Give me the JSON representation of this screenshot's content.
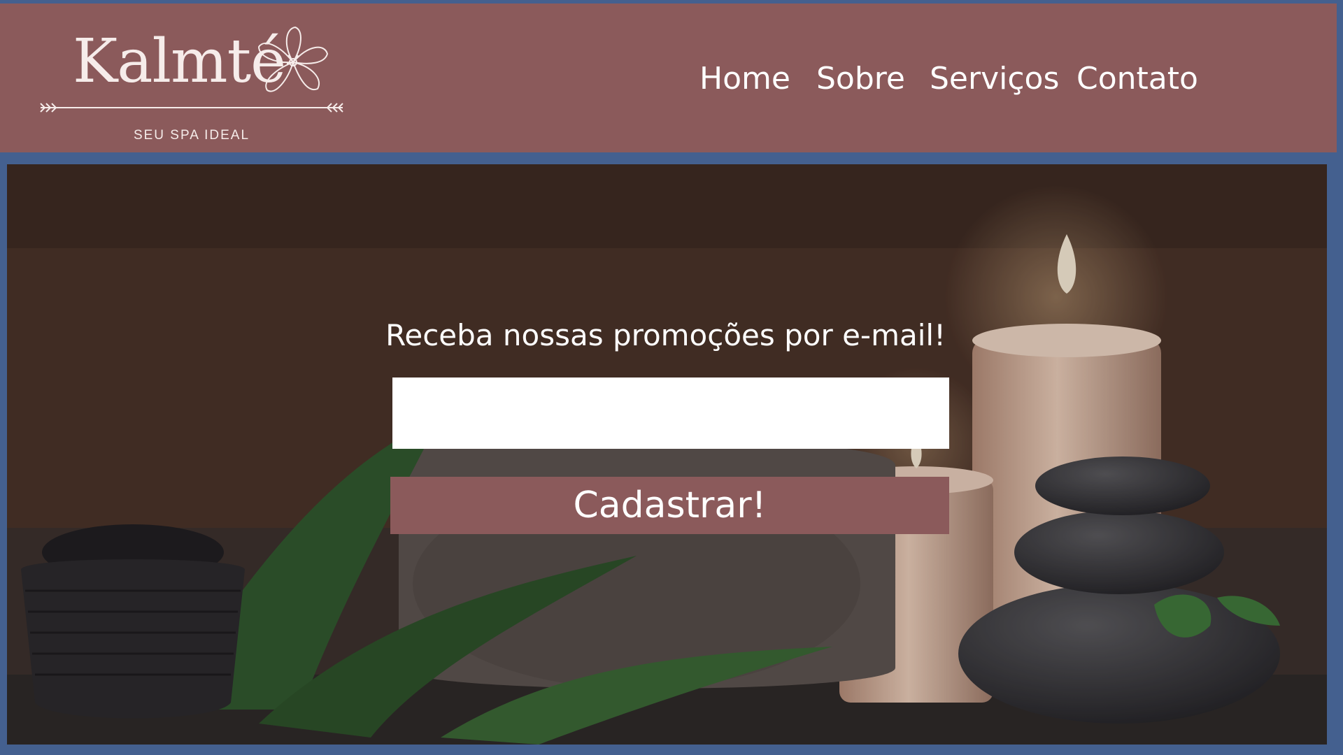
{
  "logo": {
    "wordmark": "Kalmté",
    "tagline": "SEU SPA IDEAL",
    "icon": "flower-icon"
  },
  "nav": {
    "items": [
      {
        "label": "Home"
      },
      {
        "label": "Sobre"
      },
      {
        "label": "Serviços"
      },
      {
        "label": "Contato"
      }
    ]
  },
  "hero": {
    "background": "spa scene: candles, towel, stones, ferns",
    "promo_title": "Receba nossas promoções por e-mail!",
    "email_value": "",
    "submit_label": "Cadastrar!"
  },
  "colors": {
    "brand": "#8b5a5b",
    "frame": "#44608f",
    "text_light": "#ffffff"
  }
}
